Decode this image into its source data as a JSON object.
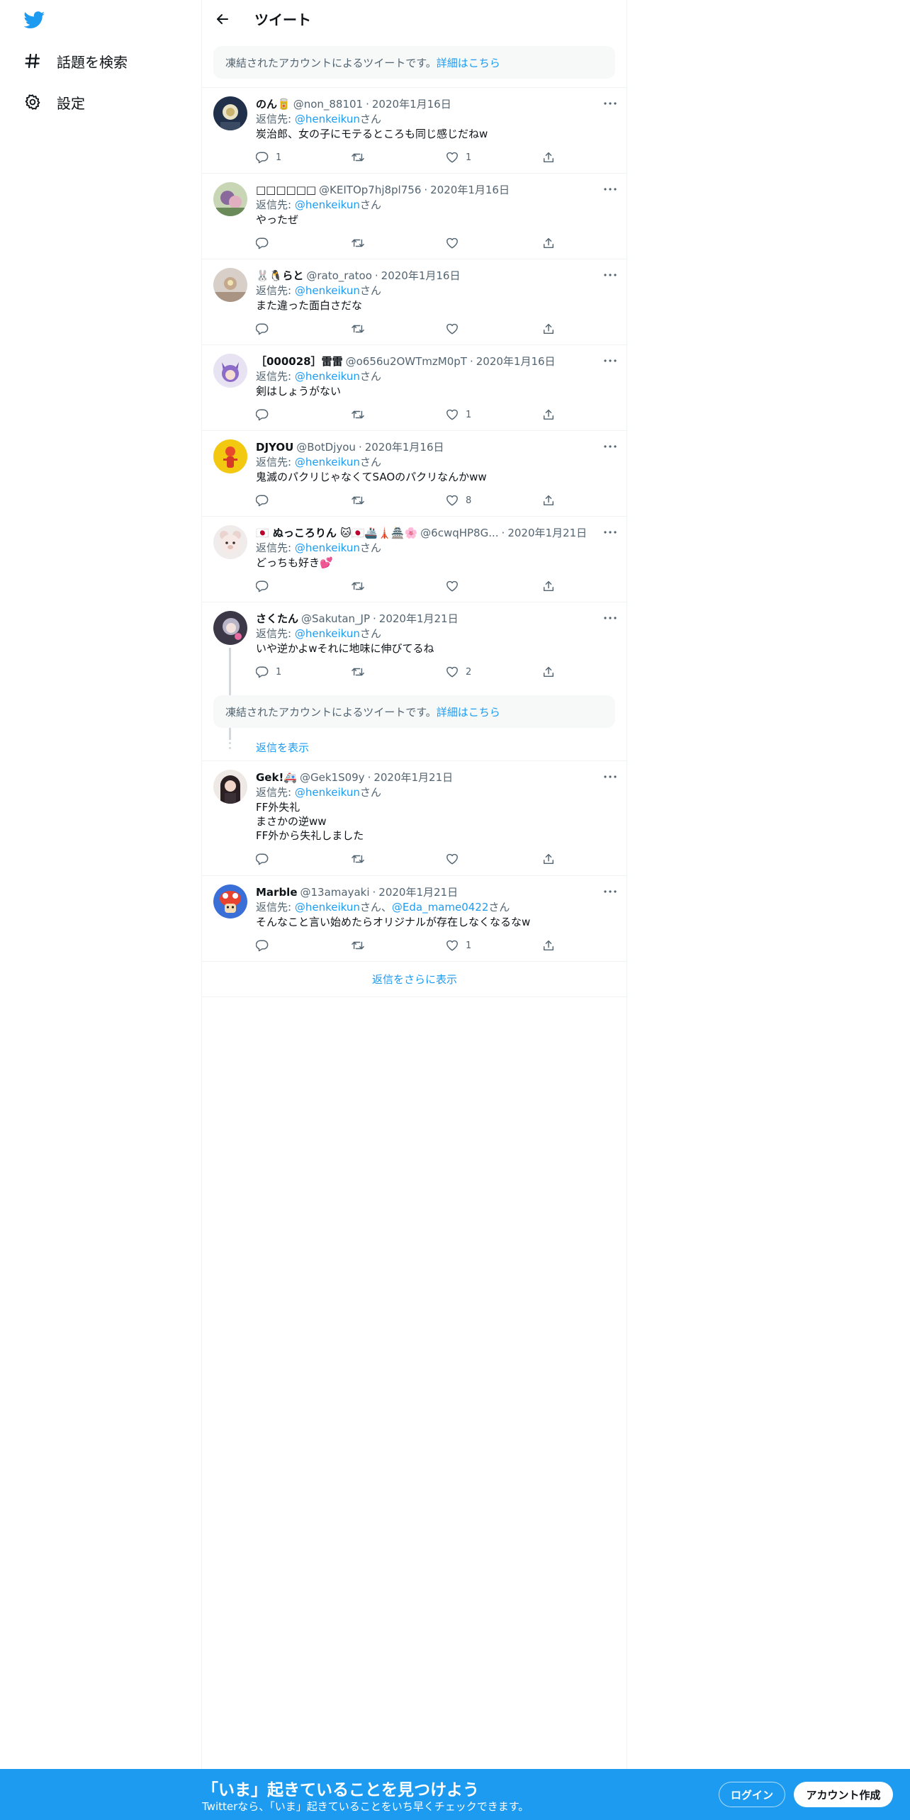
{
  "colors": {
    "accent": "#1d9bf0",
    "text": "#0f1419",
    "secondary": "#536471",
    "border": "#eff3f4",
    "notice_bg": "#f7f9f9",
    "banner_bg": "#1d9bf0"
  },
  "icons": {
    "logo": "twitter-bird-icon",
    "explore": "hashtag-icon",
    "settings": "gear-icon",
    "back": "arrow-left-icon",
    "more": "more-dots-icon",
    "reply": "comment-icon",
    "retweet": "retweet-icon",
    "like": "heart-icon",
    "share": "share-icon"
  },
  "nav": {
    "explore_label": "話題を検索",
    "settings_label": "設定"
  },
  "header": {
    "title": "ツイート"
  },
  "notice": {
    "text": "凍結されたアカウントによるツイートです。",
    "link": "詳細はこちら"
  },
  "tweets": [
    {
      "name": "のん🥫",
      "handle": "@non_88101",
      "date": "2020年1月16日",
      "reply_prefix": "返信先: ",
      "reply_to": "@henkeikun",
      "reply_suffix": "さん",
      "text": [
        "炭治郎、女の子にモテるところも同じ感じだねw"
      ],
      "replies": "1",
      "retweets": "",
      "likes": "1"
    },
    {
      "name": "□□□□□□",
      "handle": "@KEITOp7hj8pl756",
      "date": "2020年1月16日",
      "reply_prefix": "返信先: ",
      "reply_to": "@henkeikun",
      "reply_suffix": "さん",
      "text": [
        "やったぜ"
      ],
      "replies": "",
      "retweets": "",
      "likes": ""
    },
    {
      "name": "🐰🐧らと",
      "handle": "@rato_ratoo",
      "date": "2020年1月16日",
      "reply_prefix": "返信先: ",
      "reply_to": "@henkeikun",
      "reply_suffix": "さん",
      "text": [
        "また違った面白さだな"
      ],
      "replies": "",
      "retweets": "",
      "likes": ""
    },
    {
      "name": "［000028］雷雷",
      "handle": "@o656u2OWTmzM0pT",
      "date": "2020年1月16日",
      "reply_prefix": "返信先: ",
      "reply_to": "@henkeikun",
      "reply_suffix": "さん",
      "text": [
        "剣はしょうがない"
      ],
      "replies": "",
      "retweets": "",
      "likes": "1"
    },
    {
      "name": "DJYOU",
      "handle": "@BotDjyou",
      "date": "2020年1月16日",
      "reply_prefix": "返信先: ",
      "reply_to": "@henkeikun",
      "reply_suffix": "さん",
      "text": [
        "鬼滅のパクリじゃなくてSAOのパクリなんかww"
      ],
      "replies": "",
      "retweets": "",
      "likes": "8"
    },
    {
      "name": "🇯🇵 ぬっころりん 🐱🇯🇵🚢🗼🏯🌸",
      "handle": "@6cwqHP8G...",
      "date": "2020年1月21日",
      "reply_prefix": "返信先: ",
      "reply_to": "@henkeikun",
      "reply_suffix": "さん",
      "text": [
        "どっちも好き💕"
      ],
      "replies": "",
      "retweets": "",
      "likes": ""
    },
    {
      "name": "さくたん",
      "handle": "@Sakutan_JP",
      "date": "2020年1月21日",
      "reply_prefix": "返信先: ",
      "reply_to": "@henkeikun",
      "reply_suffix": "さん",
      "text": [
        "いや逆かよwそれに地味に伸びてるね"
      ],
      "replies": "1",
      "retweets": "",
      "likes": "2"
    },
    {
      "name": "Gek!🚑",
      "handle": "@Gek1S09y",
      "date": "2020年1月21日",
      "reply_prefix": "返信先: ",
      "reply_to": "@henkeikun",
      "reply_suffix": "さん",
      "text": [
        "FF外失礼",
        "まさかの逆ww",
        "FF外から失礼しました"
      ],
      "replies": "",
      "retweets": "",
      "likes": ""
    },
    {
      "name": "Marble",
      "handle": "@13amayaki",
      "date": "2020年1月21日",
      "reply_prefix": "返信先: ",
      "reply_to": "@henkeikun",
      "reply_suffix": "さん、",
      "reply_to2": "@Eda_mame0422",
      "reply_suffix2": "さん",
      "text": [
        "そんなこと言い始めたらオリジナルが存在しなくなるなw"
      ],
      "replies": "",
      "retweets": "",
      "likes": "1"
    }
  ],
  "show_replies_label": "返信を表示",
  "show_more_label": "返信をさらに表示",
  "banner": {
    "title": "「いま」起きていることを見つけよう",
    "subtitle": "Twitterなら、「いま」起きていることをいち早くチェックできます。",
    "login": "ログイン",
    "signup": "アカウント作成"
  }
}
